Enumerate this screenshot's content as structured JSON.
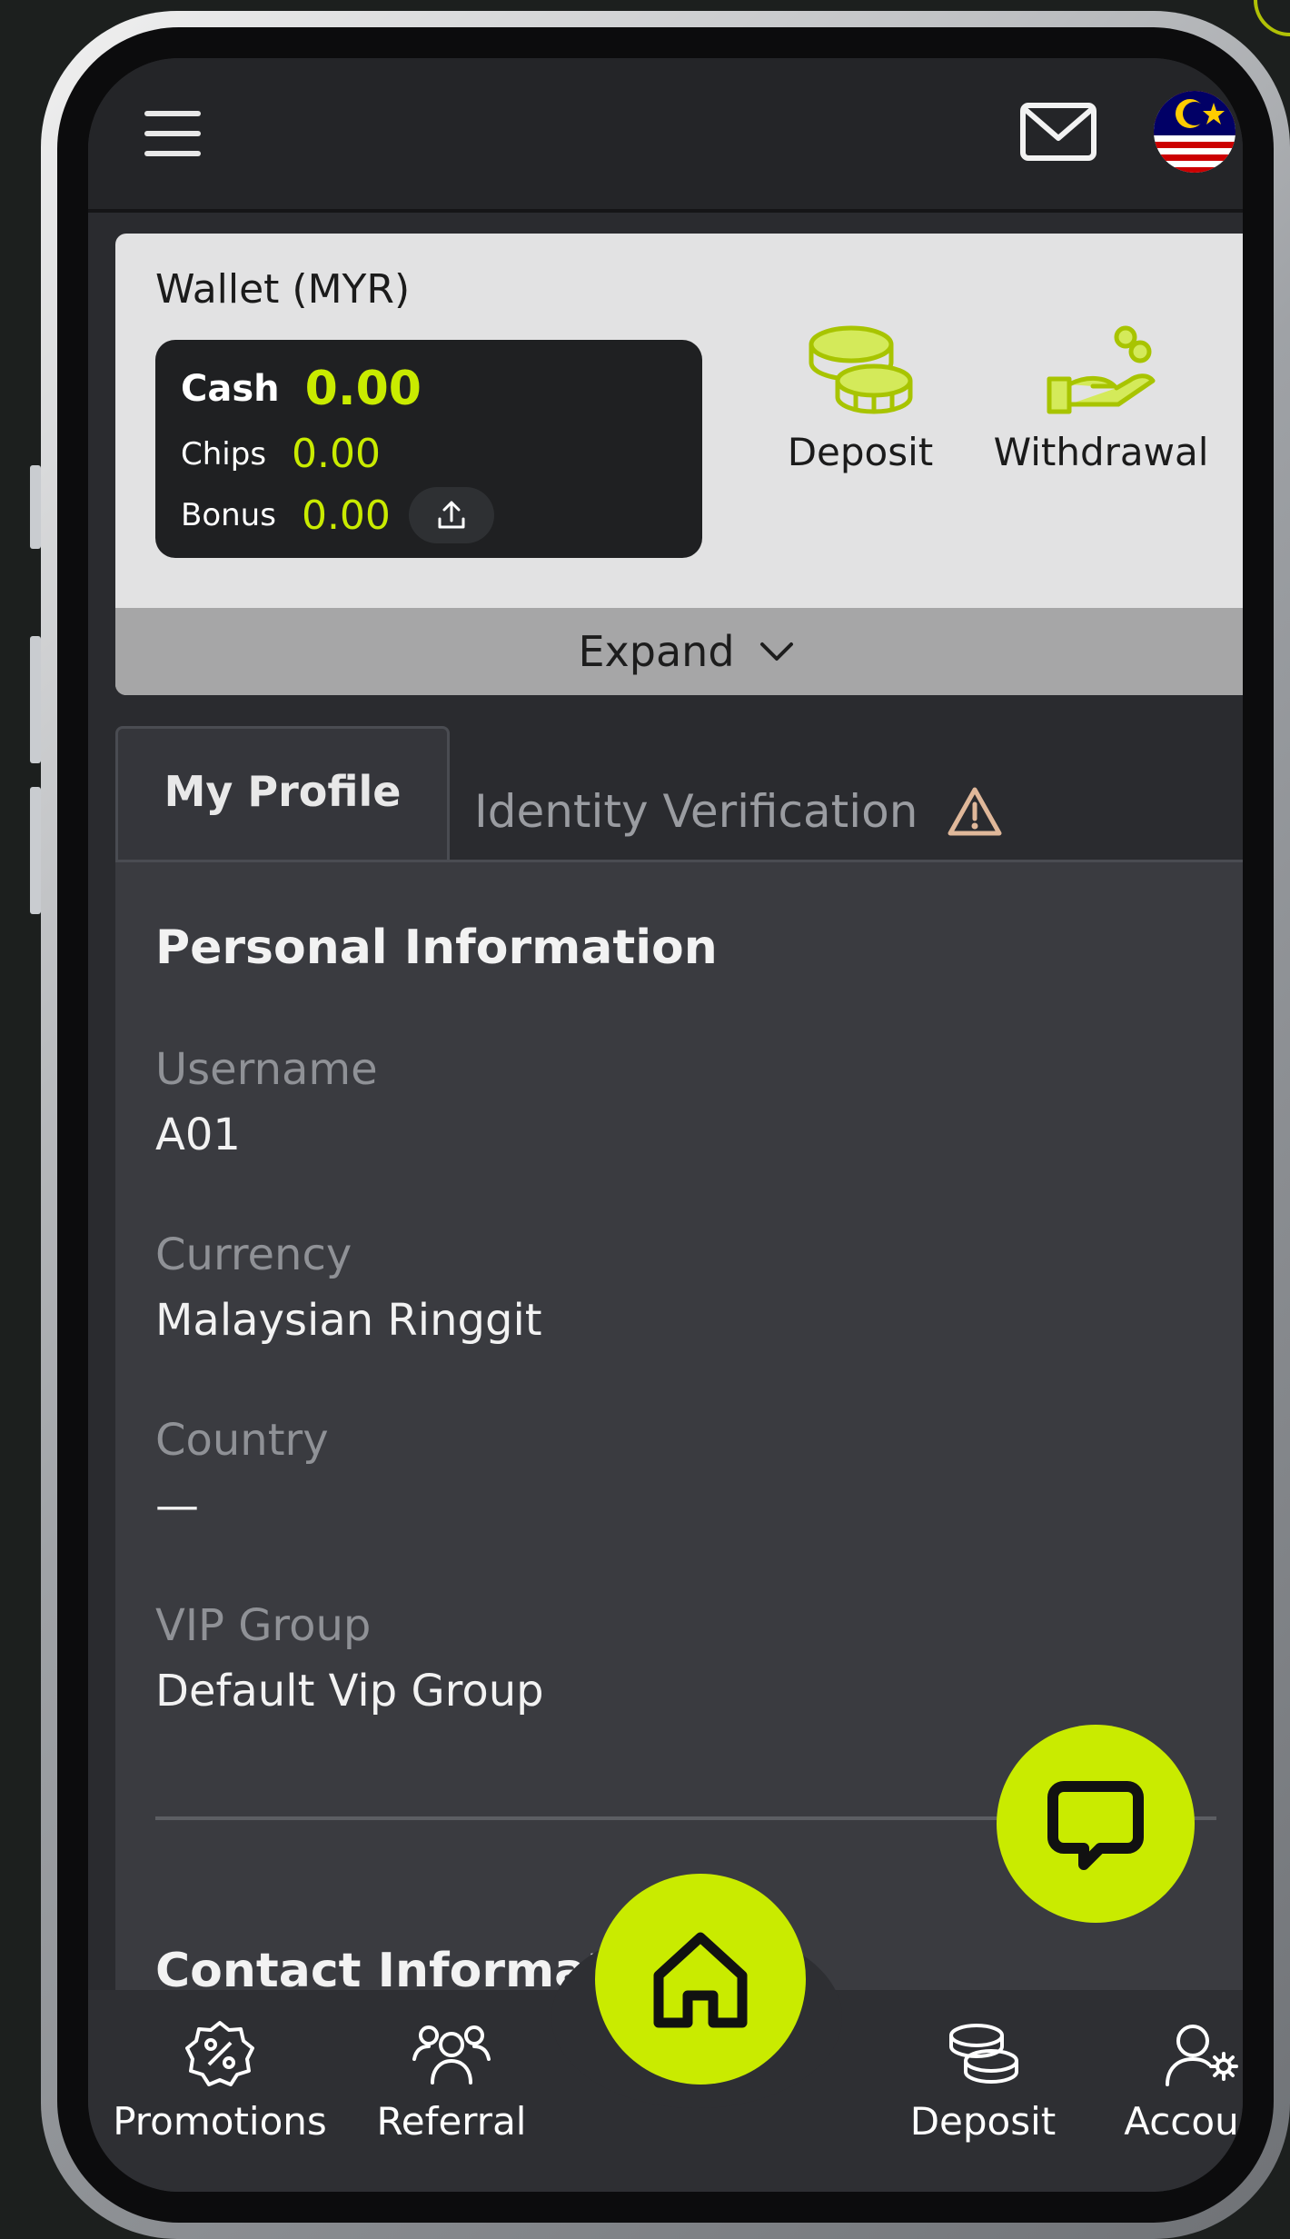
{
  "header": {
    "menu_icon": "hamburger-icon",
    "mail_icon": "mail-icon",
    "language_flag": "malaysia-flag"
  },
  "wallet": {
    "title": "Wallet (MYR)",
    "cash_label": "Cash",
    "cash_value": "0.00",
    "chips_label": "Chips",
    "chips_value": "0.00",
    "bonus_label": "Bonus",
    "bonus_value": "0.00",
    "deposit_label": "Deposit",
    "withdrawal_label": "Withdrawal",
    "expand_label": "Expand"
  },
  "tabs": {
    "my_profile": "My Profile",
    "identity_verification": "Identity Verification"
  },
  "profile": {
    "personal_title": "Personal Information",
    "fields": [
      {
        "label": "Username",
        "value": "A01"
      },
      {
        "label": "Currency",
        "value": "Malaysian Ringgit"
      },
      {
        "label": "Country",
        "value": "—"
      },
      {
        "label": "VIP Group",
        "value": "Default Vip Group"
      }
    ],
    "contact_title": "Contact Information"
  },
  "bottom_nav": {
    "promotions": "Promotions",
    "referral": "Referral",
    "deposit": "Deposit",
    "account": "Account"
  },
  "colors": {
    "accent": "#c9eb00",
    "background": "#2a2b2f",
    "panel": "#3a3b40"
  }
}
